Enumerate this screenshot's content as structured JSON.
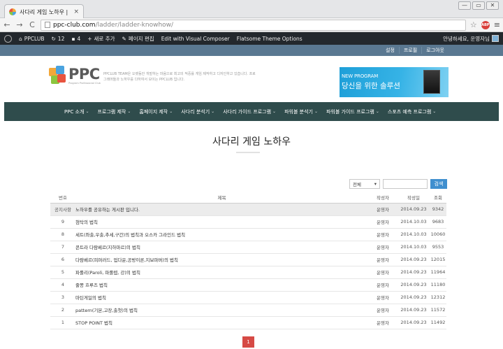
{
  "browser": {
    "tab_title": "사다리 게임 노하우 | PPC",
    "tab_close": "×",
    "window_buttons": [
      "—",
      "▭",
      "✕"
    ],
    "url_host": "ppc-club.com",
    "url_path": "/ladder/ladder-knowhow/",
    "back": "←",
    "forward": "→",
    "reload": "C",
    "star": "☆",
    "ext_badge": "ABP",
    "menu": "≡"
  },
  "adminbar": {
    "site": "PPCLUB",
    "updates": "12",
    "comments": "4",
    "new": "새로 추가",
    "edit": "페이지 편집",
    "composer": "Edit with Visual Composer",
    "flatsome": "Flatsome Theme Options",
    "greeting": "안녕하세요, 운영자님"
  },
  "utility": [
    "설정",
    "프로필",
    "로그아웃"
  ],
  "header": {
    "logo": "PPC",
    "logo_sub": "Program Professional Club",
    "tagline": "PPCLUB TEAM은 오랫동안 개발하는 마음으로 최고의 적중률 게임 제작하고 디자인하고 있습니다. 프로그래머들과 노하우를 다하여서 모이는 PPCLUB 입니다.",
    "banner_line1": "NEW PROGRAM",
    "banner_line2": "당신을 위한 솔루션"
  },
  "nav": [
    "PPC 소개",
    "프로그램 제작",
    "홈페이지 제작",
    "사다리 분석기",
    "사다리 가이드 프로그램",
    "파워볼 분석기",
    "파워볼 가이드 프로그램",
    "스포츠 예측 프로그램"
  ],
  "page": {
    "title": "사다리 게임 노하우"
  },
  "search": {
    "select": "전체",
    "button": "검색"
  },
  "table": {
    "headers": [
      "번호",
      "제목",
      "작성자",
      "작성일",
      "조회"
    ],
    "rows": [
      {
        "no": "공지사항",
        "subject": "노하우를 공유하는 게시판 입니다.",
        "author": "운영자",
        "date": "2014.09.23",
        "views": "9342"
      },
      {
        "no": "9",
        "subject": "첨탁의 법칙",
        "author": "운영자",
        "date": "2014.10.03",
        "views": "9683"
      },
      {
        "no": "8",
        "subject": "세트(좌출,우출,추세,구간)의 법칙과 오스카 그라인드 법칙",
        "author": "운영자",
        "date": "2014.10.03",
        "views": "10060"
      },
      {
        "no": "7",
        "subject": "콘트라 다람베르(지하마르)의 법칙",
        "author": "운영자",
        "date": "2014.10.03",
        "views": "9553"
      },
      {
        "no": "6",
        "subject": "다람베르(피퍼러드, 업다운,공방이론,지보파버)의 법칙",
        "author": "운영자",
        "date": "2014.09.23",
        "views": "12015"
      },
      {
        "no": "5",
        "subject": "파롤리(Paroli, 파롤렙, 강)의 법칙",
        "author": "운영자",
        "date": "2014.09.23",
        "views": "11964"
      },
      {
        "no": "4",
        "subject": "줄쫑 흐루즈 법칙",
        "author": "운영자",
        "date": "2014.09.23",
        "views": "11180"
      },
      {
        "no": "3",
        "subject": "마틴게일의 법칙",
        "author": "운영자",
        "date": "2014.09.23",
        "views": "12312"
      },
      {
        "no": "2",
        "subject": "pattern(기본,고장,출첫)의 법칙",
        "author": "운영자",
        "date": "2014.09.23",
        "views": "11572"
      },
      {
        "no": "1",
        "subject": "STOP POINT 법칙",
        "author": "운영자",
        "date": "2014.09.23",
        "views": "11492"
      }
    ]
  },
  "pagination": {
    "current": "1"
  }
}
